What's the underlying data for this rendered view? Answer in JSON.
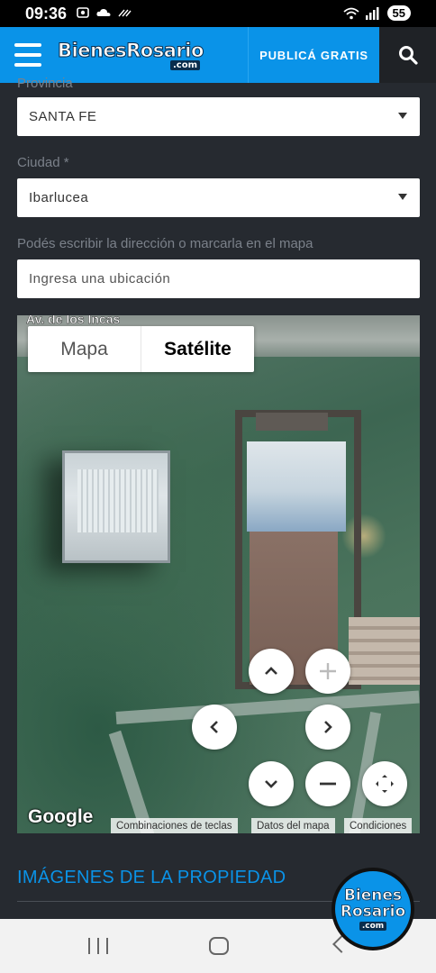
{
  "status_bar": {
    "time": "09:36",
    "battery": "55",
    "left_icons": [
      "screen-record-icon",
      "cloud-icon",
      "signal-noise-icon"
    ],
    "right_icons": [
      "wifi-icon",
      "cell-signal-icon"
    ]
  },
  "header": {
    "logo_text": "BienesRosario",
    "logo_suffix": ".com",
    "publish_label": "PUBLICÁ GRATIS",
    "search_icon": "search-icon",
    "menu_icon": "hamburger-menu-icon",
    "brand_color": "#0a93e8"
  },
  "form": {
    "province_label": "Provincia",
    "province_value": "SANTA FE",
    "city_label": "Ciudad *",
    "city_value": "Ibarlucea",
    "address_label": "Podés escribir la dirección o marcarla en el mapa",
    "address_placeholder": "Ingresa una ubicación"
  },
  "map": {
    "road_label": "Av. de los Incas",
    "tab_map": "Mapa",
    "tab_satellite": "Satélite",
    "selected_tab": "Satélite",
    "google_logo": "Google",
    "attribution": {
      "shortcuts": "Combinaciones de teclas",
      "map_data": "Datos del mapa",
      "terms": "Condiciones"
    },
    "controls": [
      "pan-up-icon",
      "zoom-in-icon",
      "pan-left-icon",
      "pan-right-icon",
      "pan-down-icon",
      "zoom-out-icon",
      "fullscreen-icon"
    ]
  },
  "section": {
    "title": "IMÁGENES DE LA PROPIEDAD"
  },
  "fab": {
    "line1": "Bienes",
    "line2": "Rosario",
    "suffix": ".com"
  }
}
